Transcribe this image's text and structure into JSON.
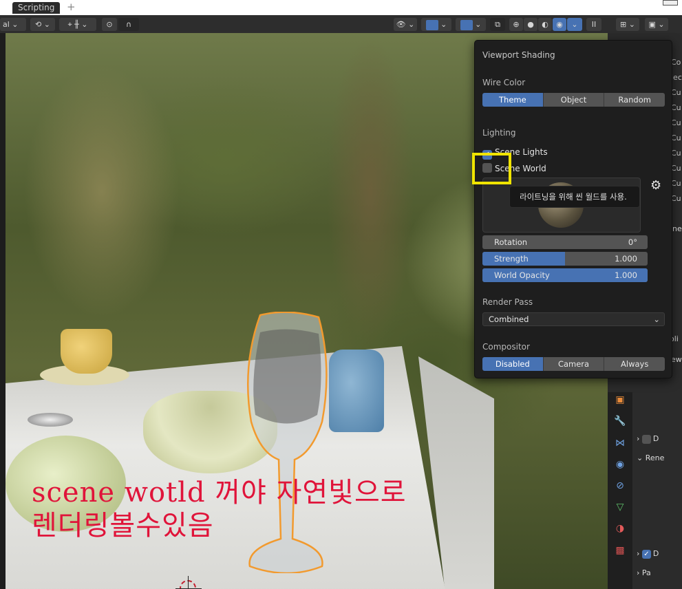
{
  "workspace_tabs": {
    "active": "Scripting",
    "add_label": "+"
  },
  "viewport_header": {
    "transform_orientation": "al",
    "shading_modes": [
      "wireframe",
      "solid",
      "material-preview",
      "rendered"
    ],
    "active_shading": "rendered",
    "pause_label": "II"
  },
  "viewport_shading_popover": {
    "title": "Viewport Shading",
    "wire_color": {
      "label": "Wire Color",
      "options": [
        "Theme",
        "Object",
        "Random"
      ],
      "selected": "Theme"
    },
    "lighting": {
      "label": "Lighting",
      "scene_lights": {
        "label": "Scene Lights",
        "checked": true
      },
      "scene_world": {
        "label": "Scene World",
        "checked": false
      }
    },
    "hdri_sliders": [
      {
        "label": "Rotation",
        "value": "0°",
        "fill": 0.0
      },
      {
        "label": "Strength",
        "value": "1.000",
        "fill": 0.5
      },
      {
        "label": "World Opacity",
        "value": "1.000",
        "fill": 1.0
      }
    ],
    "render_pass": {
      "label": "Render Pass",
      "value": "Combined"
    },
    "compositor": {
      "label": "Compositor",
      "options": [
        "Disabled",
        "Camera",
        "Always"
      ],
      "selected": "Disabled"
    }
  },
  "tooltip": {
    "text": "라이트닝을 위해 씬 월드를 사용."
  },
  "annotation": {
    "line1": "scene wotld 꺼야 자연빛으로",
    "line2": "렌더링볼수있음",
    "color": "#e0143a"
  },
  "outliner_partial": [
    "Co",
    "lec",
    "Cu",
    "Cu",
    "Cu",
    "Cu",
    "Cu",
    "Cu",
    "Cu",
    "Cu"
  ],
  "properties_partial": {
    "side_text_1": "ne",
    "side_text_2": "oli",
    "side_text_3": "ew",
    "rows": [
      {
        "text": "D",
        "checked": false
      },
      {
        "text": "Rene",
        "checked": null
      },
      {
        "text": "D",
        "checked": true
      },
      {
        "text": "Pa",
        "checked": null
      }
    ]
  },
  "colors": {
    "accent": "#4772b3",
    "highlight_box": "#f0e400",
    "popover_bg": "#1e1e1e"
  }
}
